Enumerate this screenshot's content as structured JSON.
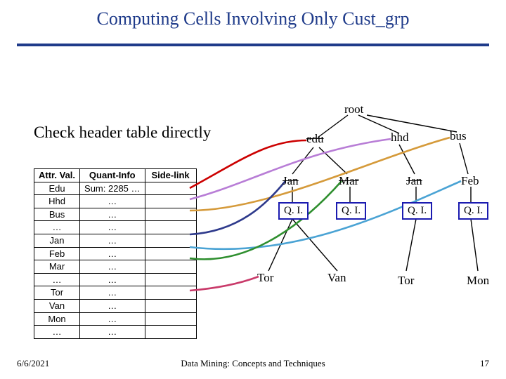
{
  "title": "Computing Cells Involving Only Cust_grp",
  "subhead": "Check header table directly",
  "table": {
    "headers": [
      "Attr. Val.",
      "Quant-Info",
      "Side-link"
    ],
    "rows": [
      [
        "Edu",
        "Sum: 2285 …",
        ""
      ],
      [
        "Hhd",
        "…",
        ""
      ],
      [
        "Bus",
        "…",
        ""
      ],
      [
        "…",
        "…",
        ""
      ],
      [
        "Jan",
        "…",
        ""
      ],
      [
        "Feb",
        "…",
        ""
      ],
      [
        "Mar",
        "…",
        ""
      ],
      [
        "…",
        "…",
        ""
      ],
      [
        "Tor",
        "…",
        ""
      ],
      [
        "Van",
        "…",
        ""
      ],
      [
        "Mon",
        "…",
        ""
      ],
      [
        "…",
        "…",
        ""
      ]
    ]
  },
  "tree": {
    "root": "root",
    "level1": {
      "edu": "edu",
      "hhd": "hhd",
      "bus": "bus"
    },
    "level2": {
      "jan": "Jan",
      "mar": "Mar",
      "jan2": "Jan",
      "feb": "Feb"
    },
    "qi": "Q. I.",
    "level4": {
      "tor": "Tor",
      "van": "Van",
      "tor2": "Tor",
      "mon": "Mon"
    }
  },
  "footer": {
    "date": "6/6/2021",
    "middle": "Data Mining: Concepts and Techniques",
    "page": "17"
  }
}
